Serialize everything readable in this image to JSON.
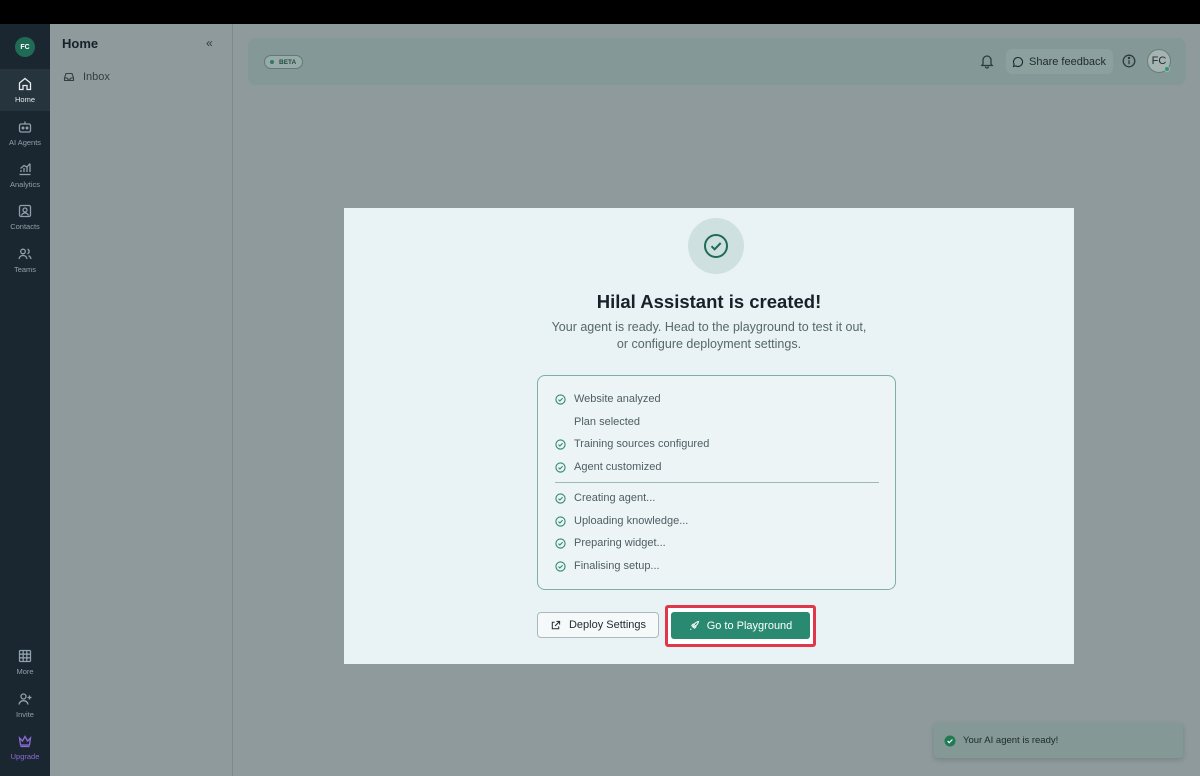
{
  "user_initials": "FC",
  "rail": {
    "items": [
      {
        "label": "Home",
        "icon": "home-icon",
        "active": true
      },
      {
        "label": "AI Agents",
        "icon": "robot-icon"
      },
      {
        "label": "Analytics",
        "icon": "analytics-icon"
      },
      {
        "label": "Contacts",
        "icon": "contacts-icon"
      },
      {
        "label": "Teams",
        "icon": "teams-icon"
      }
    ],
    "bottom_items": [
      {
        "label": "More",
        "icon": "grid-icon"
      },
      {
        "label": "Invite",
        "icon": "user-plus-icon"
      },
      {
        "label": "Upgrade",
        "icon": "crown-icon"
      }
    ]
  },
  "side_panel": {
    "title": "Home",
    "collapse_glyph": "«",
    "items": [
      {
        "label": "Inbox",
        "icon": "inbox-icon"
      }
    ]
  },
  "header": {
    "badge": "BETA",
    "share_feedback": "Share feedback",
    "avatar": "FC"
  },
  "modal": {
    "title": "Hilal Assistant is created!",
    "subtitle": "Your agent is ready. Head to the playground to test it out, or configure deployment settings.",
    "steps_done": [
      {
        "label": "Website analyzed",
        "checked": true
      },
      {
        "label": "Plan selected",
        "checked": false
      },
      {
        "label": "Training sources configured",
        "checked": true
      },
      {
        "label": "Agent customized",
        "checked": true
      }
    ],
    "steps_progress": [
      {
        "label": "Creating agent...",
        "checked": true
      },
      {
        "label": "Uploading knowledge...",
        "checked": true
      },
      {
        "label": "Preparing widget...",
        "checked": true
      },
      {
        "label": "Finalising setup...",
        "checked": true
      }
    ],
    "deploy_button": "Deploy Settings",
    "playground_button": "Go to Playground"
  },
  "toast": {
    "message": "Your AI agent is ready!"
  },
  "colors": {
    "accent": "#2a8a71",
    "highlight": "#e0384a",
    "upgrade": "#8b6ad8"
  }
}
